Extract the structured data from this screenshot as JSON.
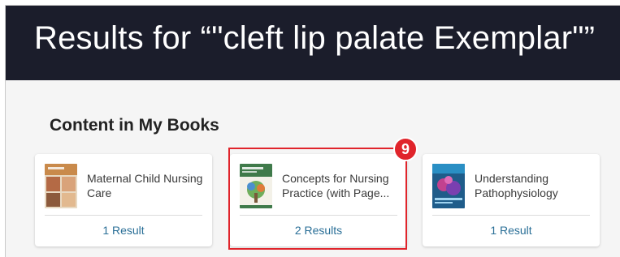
{
  "header": {
    "title": "Results for “\"cleft lip palate Exemplar\"”"
  },
  "section": {
    "title": "Content in My Books"
  },
  "cards": [
    {
      "title": "Maternal Child Nursing Care",
      "results": "1 Result",
      "cover_icon": "book-cover-maternal-child-icon"
    },
    {
      "title": "Concepts for Nursing Practice (with Page...",
      "results": "2 Results",
      "cover_icon": "book-cover-concepts-nursing-icon"
    },
    {
      "title": "Understanding Pathophysiology",
      "results": "1 Result",
      "cover_icon": "book-cover-pathophysiology-icon"
    }
  ],
  "annotation": {
    "badge": "9"
  },
  "colors": {
    "header_bg": "#1b1d2b",
    "link": "#2a6f97",
    "highlight": "#e0242b"
  }
}
